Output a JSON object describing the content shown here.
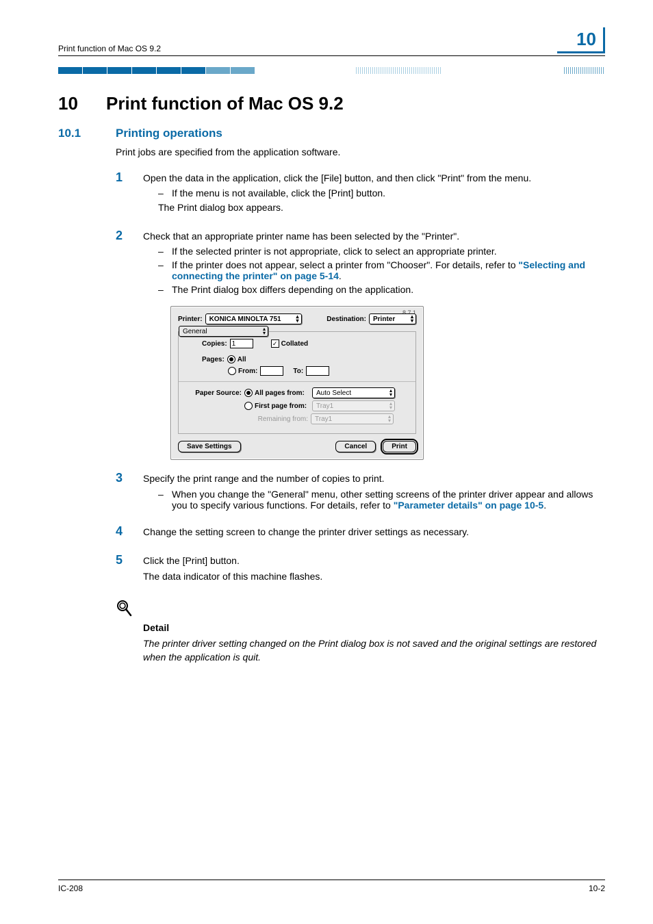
{
  "header": {
    "running_head": "Print function of Mac OS 9.2",
    "chapter_number": "10"
  },
  "chapter": {
    "number": "10",
    "title": "Print function of Mac OS 9.2"
  },
  "section": {
    "number": "10.1",
    "title": "Printing operations",
    "intro": "Print jobs are specified from the application software."
  },
  "steps": {
    "s1": {
      "num": "1",
      "text": "Open the data in the application, click the [File] button, and then click \"Print\" from the menu.",
      "sub1_dash": "–",
      "sub1": "If the menu is not available, click the [Print] button.",
      "after": "The Print dialog box appears."
    },
    "s2": {
      "num": "2",
      "text": "Check that an appropriate printer name has been selected by the \"Printer\".",
      "sub1_dash": "–",
      "sub1": "If the selected printer is not appropriate, click to select an appropriate printer.",
      "sub2_dash": "–",
      "sub2a": "If the printer does not appear, select a printer from \"Chooser\". For details, refer to ",
      "sub2_link": "\"Selecting and connecting the printer\" on page 5-14",
      "sub2b": ".",
      "sub3_dash": "–",
      "sub3": "The Print dialog box differs depending on the application."
    },
    "s3": {
      "num": "3",
      "text": "Specify the print range and the number of copies to print.",
      "sub1_dash": "–",
      "sub1a": "When you change the \"General\" menu, other setting screens of the printer driver appear and allows you to specify various functions. For details, refer to ",
      "sub1_link": "\"Parameter details\" on page 10-5",
      "sub1b": "."
    },
    "s4": {
      "num": "4",
      "text": "Change the setting screen to change the printer driver settings as necessary."
    },
    "s5": {
      "num": "5",
      "text": "Click the [Print] button.",
      "after": "The data indicator of this machine flashes."
    }
  },
  "dialog": {
    "version": "8.7.1",
    "printer_label": "Printer:",
    "printer_value": "KONICA MINOLTA 751",
    "destination_label": "Destination:",
    "destination_value": "Printer",
    "tab_value": "General",
    "copies_label": "Copies:",
    "copies_value": "1",
    "collated_label": "Collated",
    "pages_label": "Pages:",
    "pages_all": "All",
    "pages_from": "From:",
    "pages_to": "To:",
    "papersource_label": "Paper Source:",
    "papersource_all_label": "All pages from:",
    "papersource_all_value": "Auto Select",
    "papersource_first_label": "First page from:",
    "papersource_first_value": "Tray1",
    "papersource_remaining_label": "Remaining from:",
    "papersource_remaining_value": "Tray1",
    "save_settings": "Save Settings",
    "cancel": "Cancel",
    "print": "Print"
  },
  "detail": {
    "heading": "Detail",
    "text": "The printer driver setting changed on the Print dialog box is not saved and the original settings are restored when the application is quit."
  },
  "footer": {
    "left": "IC-208",
    "right": "10-2"
  }
}
